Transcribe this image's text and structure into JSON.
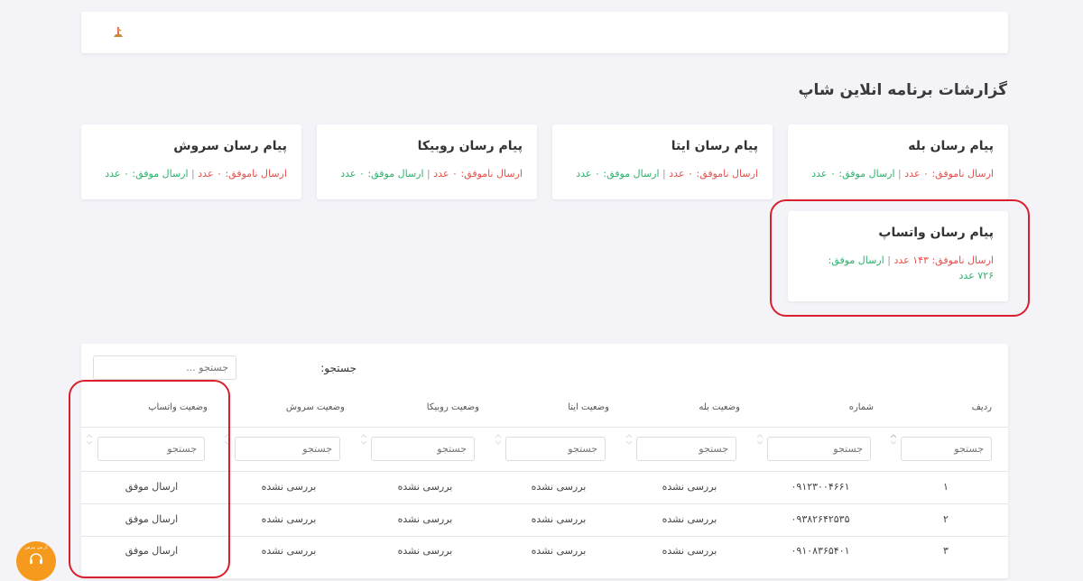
{
  "page": {
    "title": "گزارشات برنامه انلاین شاپ"
  },
  "cards": [
    {
      "title": "پیام رسان بله",
      "fail_label": "ارسال ناموفق:",
      "fail_count": "۰",
      "fail_unit": "عدد",
      "sep": "|",
      "success_label": "ارسال موفق:",
      "success_count": "۰",
      "success_unit": "عدد"
    },
    {
      "title": "پیام رسان ایتا",
      "fail_label": "ارسال ناموفق:",
      "fail_count": "۰",
      "fail_unit": "عدد",
      "sep": "|",
      "success_label": "ارسال موفق:",
      "success_count": "۰",
      "success_unit": "عدد"
    },
    {
      "title": "پیام رسان روبیکا",
      "fail_label": "ارسال ناموفق:",
      "fail_count": "۰",
      "fail_unit": "عدد",
      "sep": "|",
      "success_label": "ارسال موفق:",
      "success_count": "۰",
      "success_unit": "عدد"
    },
    {
      "title": "پیام رسان سروش",
      "fail_label": "ارسال ناموفق:",
      "fail_count": "۰",
      "fail_unit": "عدد",
      "sep": "|",
      "success_label": "ارسال موفق:",
      "success_count": "۰",
      "success_unit": "عدد"
    },
    {
      "title": "پیام رسان واتساپ",
      "fail_label": "ارسال ناموفق:",
      "fail_count": "۱۴۳",
      "fail_unit": "عدد",
      "sep": "|",
      "success_label": "ارسال موفق:",
      "success_count": "۷۲۶",
      "success_unit": "عدد"
    }
  ],
  "table": {
    "search_label": "جستجو:",
    "search_placeholder": "جستجو ...",
    "filter_placeholder": "جستجو",
    "headers": [
      "ردیف",
      "شماره",
      "وضعیت بله",
      "وضعیت ایتا",
      "وضعیت روبیکا",
      "وضعیت سروش",
      "وضعیت واتساپ"
    ],
    "rows": [
      [
        "۱",
        "۰۹۱۲۳۰۰۴۶۶۱",
        "بررسی نشده",
        "بررسی نشده",
        "بررسی نشده",
        "بررسی نشده",
        "ارسال موفق"
      ],
      [
        "۲",
        "۰۹۳۸۲۶۴۲۵۳۵",
        "بررسی نشده",
        "بررسی نشده",
        "بررسی نشده",
        "بررسی نشده",
        "ارسال موفق"
      ],
      [
        "۳",
        "۰۹۱۰۸۳۶۵۴۰۱",
        "بررسی نشده",
        "بررسی نشده",
        "بررسی نشده",
        "بررسی نشده",
        "ارسال موفق"
      ]
    ]
  },
  "support": {
    "label": "از من بپرس"
  },
  "colors": {
    "fail": "#e3524b",
    "success": "#2db36b",
    "highlight": "#d9202c",
    "support": "#f59a1c"
  }
}
